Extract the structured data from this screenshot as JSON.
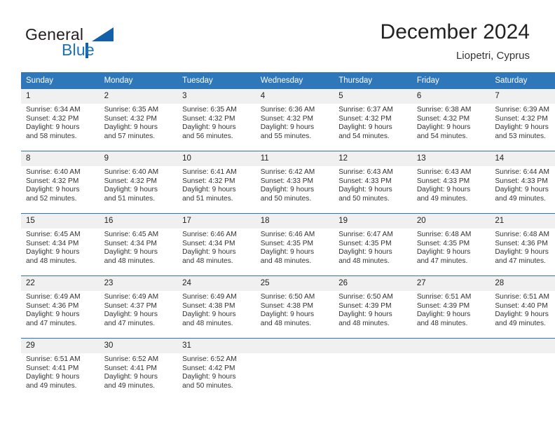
{
  "brand": {
    "name_top": "General",
    "name_bottom": "Blue",
    "accent_color": "#1260a8"
  },
  "header": {
    "month_title": "December 2024",
    "location": "Liopetri, Cyprus"
  },
  "calendar": {
    "header_color": "#2e77bb",
    "weekday_headers": [
      "Sunday",
      "Monday",
      "Tuesday",
      "Wednesday",
      "Thursday",
      "Friday",
      "Saturday"
    ],
    "weeks": [
      [
        {
          "day": "1",
          "sunrise": "Sunrise: 6:34 AM",
          "sunset": "Sunset: 4:32 PM",
          "daylight_1": "Daylight: 9 hours",
          "daylight_2": "and 58 minutes."
        },
        {
          "day": "2",
          "sunrise": "Sunrise: 6:35 AM",
          "sunset": "Sunset: 4:32 PM",
          "daylight_1": "Daylight: 9 hours",
          "daylight_2": "and 57 minutes."
        },
        {
          "day": "3",
          "sunrise": "Sunrise: 6:35 AM",
          "sunset": "Sunset: 4:32 PM",
          "daylight_1": "Daylight: 9 hours",
          "daylight_2": "and 56 minutes."
        },
        {
          "day": "4",
          "sunrise": "Sunrise: 6:36 AM",
          "sunset": "Sunset: 4:32 PM",
          "daylight_1": "Daylight: 9 hours",
          "daylight_2": "and 55 minutes."
        },
        {
          "day": "5",
          "sunrise": "Sunrise: 6:37 AM",
          "sunset": "Sunset: 4:32 PM",
          "daylight_1": "Daylight: 9 hours",
          "daylight_2": "and 54 minutes."
        },
        {
          "day": "6",
          "sunrise": "Sunrise: 6:38 AM",
          "sunset": "Sunset: 4:32 PM",
          "daylight_1": "Daylight: 9 hours",
          "daylight_2": "and 54 minutes."
        },
        {
          "day": "7",
          "sunrise": "Sunrise: 6:39 AM",
          "sunset": "Sunset: 4:32 PM",
          "daylight_1": "Daylight: 9 hours",
          "daylight_2": "and 53 minutes."
        }
      ],
      [
        {
          "day": "8",
          "sunrise": "Sunrise: 6:40 AM",
          "sunset": "Sunset: 4:32 PM",
          "daylight_1": "Daylight: 9 hours",
          "daylight_2": "and 52 minutes."
        },
        {
          "day": "9",
          "sunrise": "Sunrise: 6:40 AM",
          "sunset": "Sunset: 4:32 PM",
          "daylight_1": "Daylight: 9 hours",
          "daylight_2": "and 51 minutes."
        },
        {
          "day": "10",
          "sunrise": "Sunrise: 6:41 AM",
          "sunset": "Sunset: 4:32 PM",
          "daylight_1": "Daylight: 9 hours",
          "daylight_2": "and 51 minutes."
        },
        {
          "day": "11",
          "sunrise": "Sunrise: 6:42 AM",
          "sunset": "Sunset: 4:33 PM",
          "daylight_1": "Daylight: 9 hours",
          "daylight_2": "and 50 minutes."
        },
        {
          "day": "12",
          "sunrise": "Sunrise: 6:43 AM",
          "sunset": "Sunset: 4:33 PM",
          "daylight_1": "Daylight: 9 hours",
          "daylight_2": "and 50 minutes."
        },
        {
          "day": "13",
          "sunrise": "Sunrise: 6:43 AM",
          "sunset": "Sunset: 4:33 PM",
          "daylight_1": "Daylight: 9 hours",
          "daylight_2": "and 49 minutes."
        },
        {
          "day": "14",
          "sunrise": "Sunrise: 6:44 AM",
          "sunset": "Sunset: 4:33 PM",
          "daylight_1": "Daylight: 9 hours",
          "daylight_2": "and 49 minutes."
        }
      ],
      [
        {
          "day": "15",
          "sunrise": "Sunrise: 6:45 AM",
          "sunset": "Sunset: 4:34 PM",
          "daylight_1": "Daylight: 9 hours",
          "daylight_2": "and 48 minutes."
        },
        {
          "day": "16",
          "sunrise": "Sunrise: 6:45 AM",
          "sunset": "Sunset: 4:34 PM",
          "daylight_1": "Daylight: 9 hours",
          "daylight_2": "and 48 minutes."
        },
        {
          "day": "17",
          "sunrise": "Sunrise: 6:46 AM",
          "sunset": "Sunset: 4:34 PM",
          "daylight_1": "Daylight: 9 hours",
          "daylight_2": "and 48 minutes."
        },
        {
          "day": "18",
          "sunrise": "Sunrise: 6:46 AM",
          "sunset": "Sunset: 4:35 PM",
          "daylight_1": "Daylight: 9 hours",
          "daylight_2": "and 48 minutes."
        },
        {
          "day": "19",
          "sunrise": "Sunrise: 6:47 AM",
          "sunset": "Sunset: 4:35 PM",
          "daylight_1": "Daylight: 9 hours",
          "daylight_2": "and 48 minutes."
        },
        {
          "day": "20",
          "sunrise": "Sunrise: 6:48 AM",
          "sunset": "Sunset: 4:35 PM",
          "daylight_1": "Daylight: 9 hours",
          "daylight_2": "and 47 minutes."
        },
        {
          "day": "21",
          "sunrise": "Sunrise: 6:48 AM",
          "sunset": "Sunset: 4:36 PM",
          "daylight_1": "Daylight: 9 hours",
          "daylight_2": "and 47 minutes."
        }
      ],
      [
        {
          "day": "22",
          "sunrise": "Sunrise: 6:49 AM",
          "sunset": "Sunset: 4:36 PM",
          "daylight_1": "Daylight: 9 hours",
          "daylight_2": "and 47 minutes."
        },
        {
          "day": "23",
          "sunrise": "Sunrise: 6:49 AM",
          "sunset": "Sunset: 4:37 PM",
          "daylight_1": "Daylight: 9 hours",
          "daylight_2": "and 47 minutes."
        },
        {
          "day": "24",
          "sunrise": "Sunrise: 6:49 AM",
          "sunset": "Sunset: 4:38 PM",
          "daylight_1": "Daylight: 9 hours",
          "daylight_2": "and 48 minutes."
        },
        {
          "day": "25",
          "sunrise": "Sunrise: 6:50 AM",
          "sunset": "Sunset: 4:38 PM",
          "daylight_1": "Daylight: 9 hours",
          "daylight_2": "and 48 minutes."
        },
        {
          "day": "26",
          "sunrise": "Sunrise: 6:50 AM",
          "sunset": "Sunset: 4:39 PM",
          "daylight_1": "Daylight: 9 hours",
          "daylight_2": "and 48 minutes."
        },
        {
          "day": "27",
          "sunrise": "Sunrise: 6:51 AM",
          "sunset": "Sunset: 4:39 PM",
          "daylight_1": "Daylight: 9 hours",
          "daylight_2": "and 48 minutes."
        },
        {
          "day": "28",
          "sunrise": "Sunrise: 6:51 AM",
          "sunset": "Sunset: 4:40 PM",
          "daylight_1": "Daylight: 9 hours",
          "daylight_2": "and 49 minutes."
        }
      ],
      [
        {
          "day": "29",
          "sunrise": "Sunrise: 6:51 AM",
          "sunset": "Sunset: 4:41 PM",
          "daylight_1": "Daylight: 9 hours",
          "daylight_2": "and 49 minutes."
        },
        {
          "day": "30",
          "sunrise": "Sunrise: 6:52 AM",
          "sunset": "Sunset: 4:41 PM",
          "daylight_1": "Daylight: 9 hours",
          "daylight_2": "and 49 minutes."
        },
        {
          "day": "31",
          "sunrise": "Sunrise: 6:52 AM",
          "sunset": "Sunset: 4:42 PM",
          "daylight_1": "Daylight: 9 hours",
          "daylight_2": "and 50 minutes."
        },
        {
          "day": "",
          "sunrise": "",
          "sunset": "",
          "daylight_1": "",
          "daylight_2": ""
        },
        {
          "day": "",
          "sunrise": "",
          "sunset": "",
          "daylight_1": "",
          "daylight_2": ""
        },
        {
          "day": "",
          "sunrise": "",
          "sunset": "",
          "daylight_1": "",
          "daylight_2": ""
        },
        {
          "day": "",
          "sunrise": "",
          "sunset": "",
          "daylight_1": "",
          "daylight_2": ""
        }
      ]
    ]
  }
}
